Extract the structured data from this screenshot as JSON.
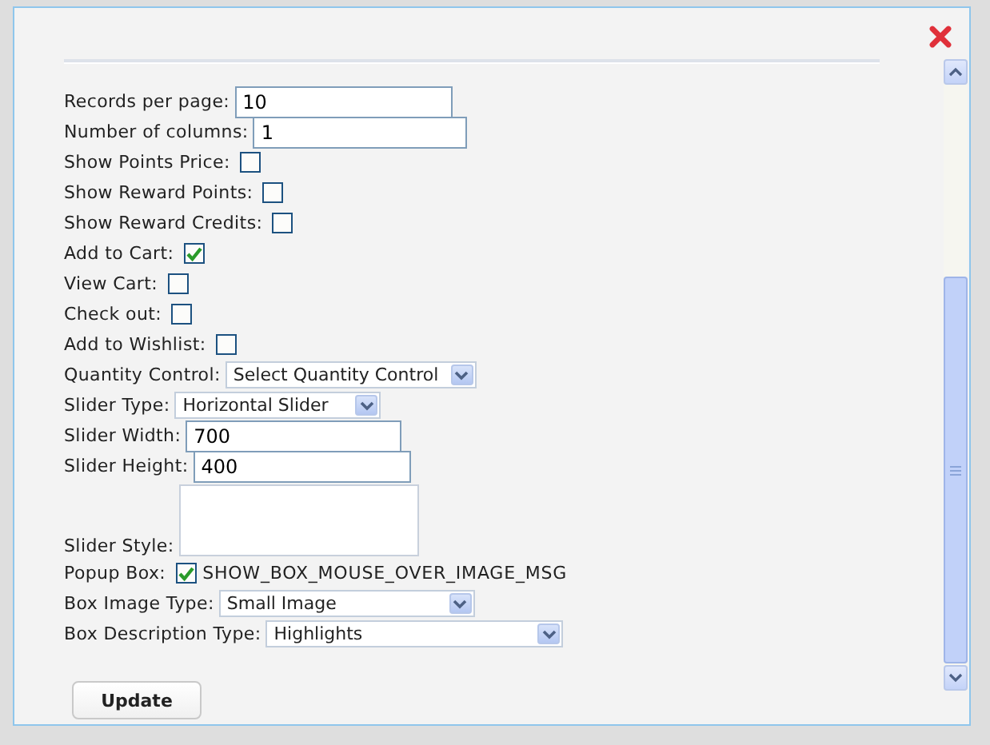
{
  "fields": [
    {
      "kind": "text",
      "label": "Records per page:",
      "value": "10"
    },
    {
      "kind": "text",
      "label": "Number of columns:",
      "value": "1"
    },
    {
      "kind": "checkbox",
      "label": "Show Points Price:",
      "checked": false
    },
    {
      "kind": "checkbox",
      "label": "Show Reward Points:",
      "checked": false
    },
    {
      "kind": "checkbox",
      "label": "Show Reward Credits:",
      "checked": false
    },
    {
      "kind": "checkbox",
      "label": "Add to Cart:",
      "checked": true
    },
    {
      "kind": "checkbox",
      "label": "View Cart:",
      "checked": false
    },
    {
      "kind": "checkbox",
      "label": "Check out:",
      "checked": false
    },
    {
      "kind": "checkbox",
      "label": "Add to Wishlist:",
      "checked": false
    },
    {
      "kind": "select",
      "label": "Quantity Control:",
      "value": "Select Quantity Control"
    },
    {
      "kind": "select",
      "label": "Slider Type:",
      "value": "Horizontal Slider"
    },
    {
      "kind": "text",
      "label": "Slider Width:",
      "value": "700"
    },
    {
      "kind": "text",
      "label": "Slider Height:",
      "value": "400"
    },
    {
      "kind": "textarea",
      "label": "Slider Style:"
    },
    {
      "kind": "checkbox",
      "label": "Popup Box:",
      "checked": true,
      "note": "SHOW_BOX_MOUSE_OVER_IMAGE_MSG"
    },
    {
      "kind": "select",
      "label": "Box Image Type:",
      "value": "Small Image"
    },
    {
      "kind": "select",
      "label": "Box Description Type:",
      "value": "Highlights"
    }
  ],
  "button": "Update"
}
